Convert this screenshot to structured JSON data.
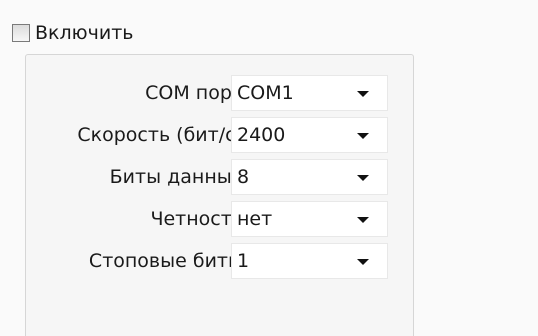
{
  "enable": {
    "label": "Включить",
    "checked": false
  },
  "settings": [
    {
      "label": "COM порт",
      "value": "COM1"
    },
    {
      "label": "Скорость (бит/с)",
      "value": "2400"
    },
    {
      "label": "Биты данных",
      "value": "8"
    },
    {
      "label": "Четность",
      "value": "нет"
    },
    {
      "label": "Стоповые биты",
      "value": "1"
    }
  ],
  "icons": {
    "checkbox": "checkbox-icon",
    "dropdown": "chevron-down-icon"
  }
}
